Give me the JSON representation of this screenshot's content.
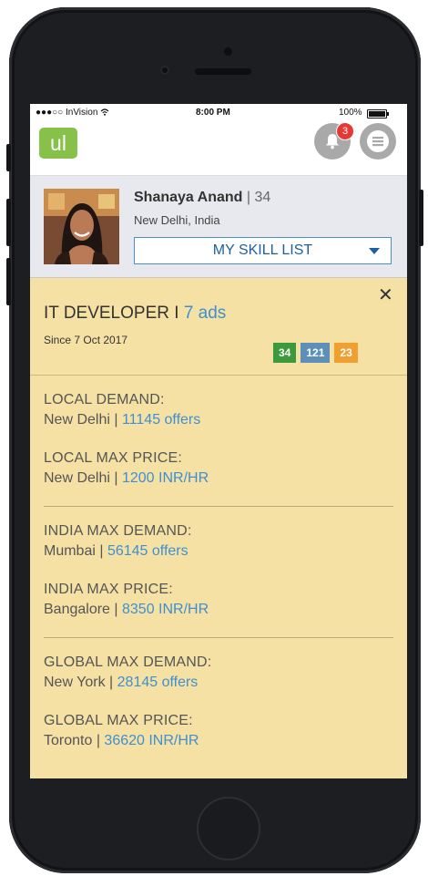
{
  "status_bar": {
    "carrier": "●●●○○ InVision ",
    "wifi_icon": "wifi-icon",
    "time": "8:00 PM",
    "battery": "100%"
  },
  "app_bar": {
    "logo_text": "ul",
    "notification_count": "3",
    "colors": {
      "logo": "#88c14a",
      "icon_bg": "#a9a9a9",
      "badge": "#e53935"
    }
  },
  "profile": {
    "name": "Shanaya Anand",
    "separator": " | ",
    "age": "34",
    "location": "New Delhi, India",
    "skill_list_label": "MY SKILL LIST"
  },
  "job": {
    "title": "IT DEVELOPER",
    "title_sep": " I ",
    "ads": "7 ads",
    "since": "Since 7 Oct 2017",
    "counts": [
      {
        "value": "34",
        "color": "#3c9a3c"
      },
      {
        "value": "121",
        "color": "#5e8fb8"
      },
      {
        "value": "23",
        "color": "#f0a030"
      }
    ]
  },
  "demand": {
    "local_demand_label": "LOCAL DEMAND:",
    "local_demand_city": "New Delhi | ",
    "local_demand_value": "11145 offers",
    "local_price_label": "LOCAL MAX PRICE:",
    "local_price_city": "New Delhi | ",
    "local_price_value": "1200 INR/HR",
    "india_demand_label": "INDIA MAX DEMAND:",
    "india_demand_city": "Mumbai | ",
    "india_demand_value": "56145 offers",
    "india_price_label": "INDIA MAX PRICE:",
    "india_price_city": "Bangalore | ",
    "india_price_value": "8350 INR/HR",
    "global_demand_label": "GLOBAL MAX DEMAND:",
    "global_demand_city": "New York | ",
    "global_demand_value": "28145 offers",
    "global_price_label": "GLOBAL MAX PRICE:",
    "global_price_city": "Toronto | ",
    "global_price_value": "36620 INR/HR"
  }
}
